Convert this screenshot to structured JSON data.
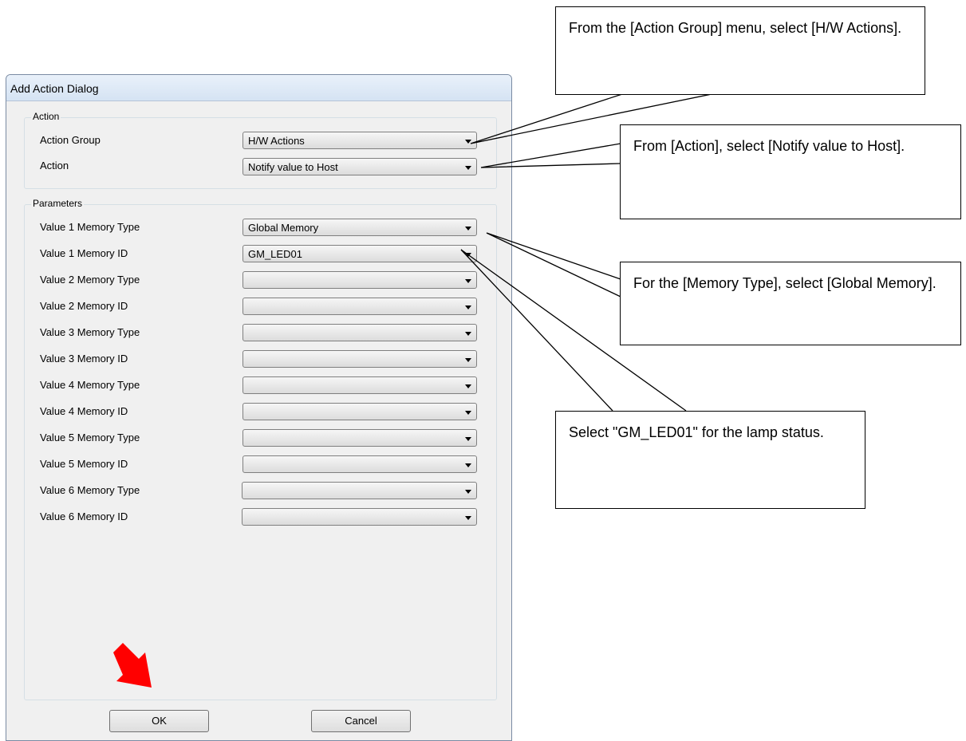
{
  "dialog": {
    "title": "Add Action Dialog",
    "action_group": {
      "legend": "Action",
      "rows": [
        {
          "label": "Action Group",
          "value": "H/W Actions"
        },
        {
          "label": "Action",
          "value": "Notify value to Host"
        }
      ]
    },
    "parameters_group": {
      "legend": "Parameters",
      "rows": [
        {
          "label": "Value 1 Memory Type",
          "value": "Global Memory"
        },
        {
          "label": "Value 1 Memory ID",
          "value": "GM_LED01"
        },
        {
          "label": "Value 2 Memory Type",
          "value": ""
        },
        {
          "label": "Value 2 Memory ID",
          "value": ""
        },
        {
          "label": "Value 3 Memory Type",
          "value": ""
        },
        {
          "label": "Value 3 Memory ID",
          "value": ""
        },
        {
          "label": "Value 4 Memory Type",
          "value": ""
        },
        {
          "label": "Value 4 Memory ID",
          "value": ""
        },
        {
          "label": "Value 5 Memory Type",
          "value": ""
        },
        {
          "label": "Value 5 Memory ID",
          "value": ""
        },
        {
          "label": "Value 6 Memory Type",
          "value": ""
        },
        {
          "label": "Value 6 Memory ID",
          "value": ""
        }
      ]
    },
    "ok_label": "OK",
    "cancel_label": "Cancel"
  },
  "callouts": {
    "action_group": "From the [Action Group] menu, select [H/W Actions].",
    "action": "From [Action], select [Notify value to Host].",
    "memory_type": "For the [Memory Type], select [Global Memory].",
    "memory_id": "Select \"GM_LED01\" for the lamp status."
  },
  "colors": {
    "pointer_arrow": "#ff0000"
  }
}
